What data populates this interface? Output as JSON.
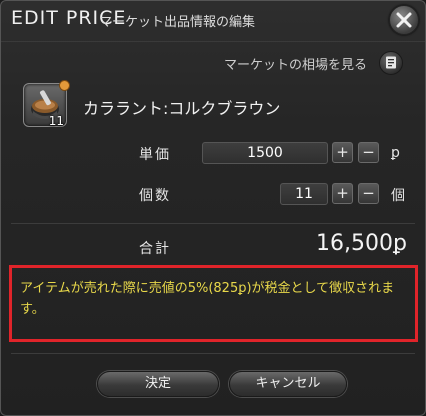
{
  "window": {
    "title": "EDIT PRICE",
    "subtitle": "マーケット出品情報の編集"
  },
  "market": {
    "link_label": "マーケットの相場を見る"
  },
  "item": {
    "name": "カララント:コルクブラウン",
    "quantity_badge": "11",
    "icon": "dye-mortar-icon"
  },
  "unit_price": {
    "label": "単価",
    "value": "1500",
    "plus": "+",
    "minus": "−",
    "currency": "ꝑ"
  },
  "quantity": {
    "label": "個数",
    "value": "11",
    "plus": "+",
    "minus": "−",
    "unit": "個"
  },
  "total": {
    "label": "合計",
    "value": "16,500ꝑ"
  },
  "notice": {
    "text": "アイテムが売れた際に売値の5%(825ꝑ)が税金として徴収されます。"
  },
  "buttons": {
    "confirm": "決定",
    "cancel": "キャンセル"
  },
  "colors": {
    "notice_text": "#e8d84a",
    "highlight_border": "#e0242a"
  }
}
